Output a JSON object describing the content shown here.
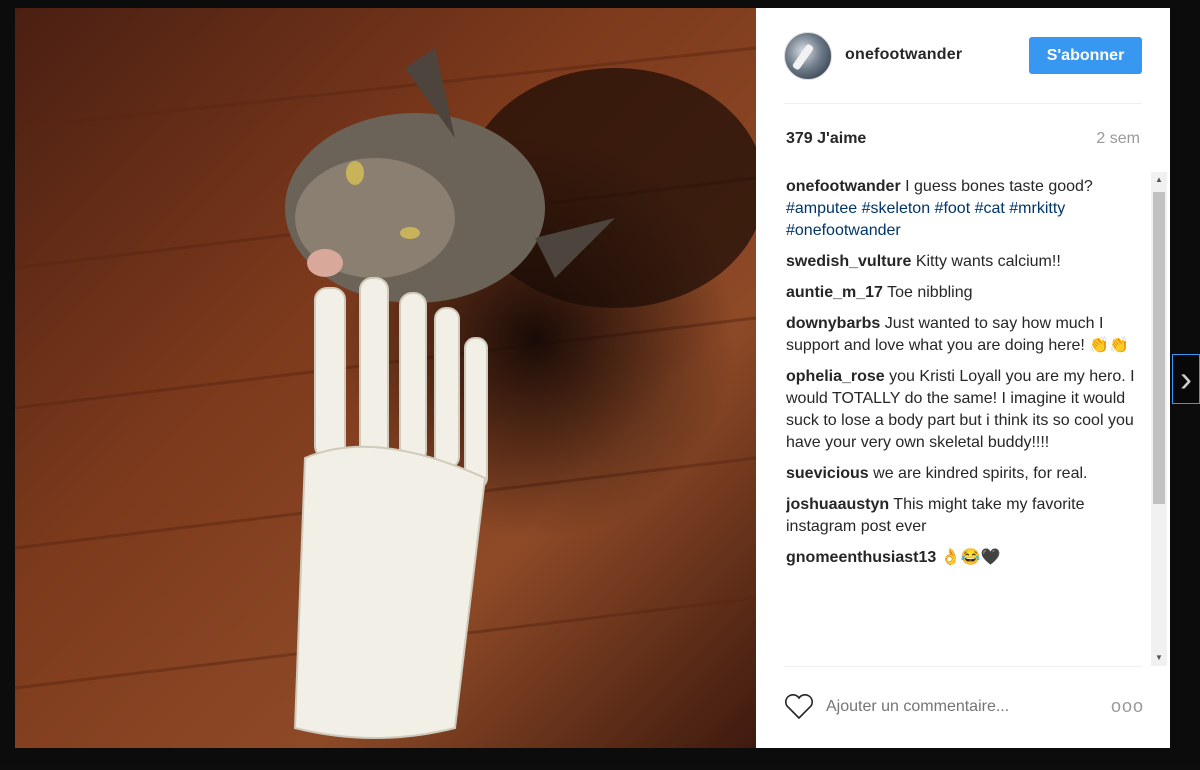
{
  "post": {
    "username": "onefootwander",
    "follow_label": "S'abonner",
    "likes": "379 J'aime",
    "time": "2 sem"
  },
  "comments": [
    {
      "user": "onefootwander",
      "text": "I guess bones taste good?",
      "tags": "#amputee #skeleton #foot #cat #mrkitty #onefootwander"
    },
    {
      "user": "swedish_vulture",
      "text": "Kitty wants calcium!!"
    },
    {
      "user": "auntie_m_17",
      "text": "Toe nibbling"
    },
    {
      "user": "downybarbs",
      "text": "Just wanted to say how much I support and love what you are doing here! 👏👏"
    },
    {
      "user": "ophelia_rose",
      "text": "you Kristi Loyall you are my hero. I would TOTALLY do the same! I imagine it would suck to lose a body part but i think its so cool you have your very own skeletal buddy!!!!"
    },
    {
      "user": "suevicious",
      "text": "we are kindred spirits, for real."
    },
    {
      "user": "joshuaaustyn",
      "text": "This might take my favorite instagram post ever"
    },
    {
      "user": "gnomeenthusiast13",
      "text": "👌😂🖤"
    }
  ],
  "footer": {
    "comment_placeholder": "Ajouter un commentaire...",
    "heart_icon": "heart-icon",
    "more_icon": "more-options-icon",
    "more_glyph": "ooo"
  },
  "nav": {
    "next_icon": "chevron-right-icon",
    "next_glyph": "›"
  },
  "colors": {
    "accent": "#3897f0",
    "tag": "#003569"
  }
}
